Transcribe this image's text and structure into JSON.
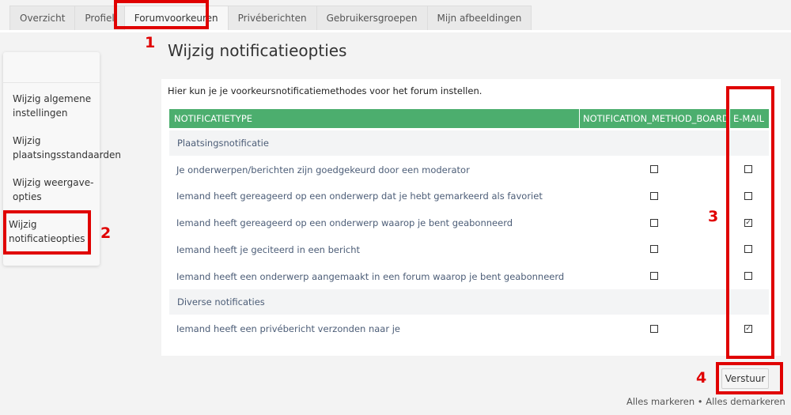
{
  "tabs": [
    "Overzicht",
    "Profiel",
    "Forumvoorkeuren",
    "Privéberichten",
    "Gebruikersgroepen",
    "Mijn afbeeldingen"
  ],
  "sidebar": {
    "items": [
      {
        "line1": "Wijzig algemene",
        "line2": "instellingen"
      },
      {
        "line1": "Wijzig",
        "line2": "plaatsingsstandaarden"
      },
      {
        "line1": "Wijzig weergave-",
        "line2": "opties"
      },
      {
        "line1": "Wijzig",
        "line2": "notificatieopties"
      }
    ]
  },
  "main": {
    "title": "Wijzig notificatieopties",
    "intro": "Hier kun je je voorkeursnotificatiemethodes voor het forum instellen.",
    "columns": [
      "Notificatietype",
      "NOTIFICATION_METHOD_BOARD",
      "E-mail"
    ],
    "groups": [
      "Plaatsingsnotificatie",
      "Diverse notificaties"
    ],
    "rows": [
      {
        "label": "Je onderwerpen/berichten zijn goedgekeurd door een moderator",
        "board": false,
        "email": false
      },
      {
        "label": "Iemand heeft gereageerd op een onderwerp dat je hebt gemarkeerd als favoriet",
        "board": false,
        "email": false
      },
      {
        "label": "Iemand heeft gereageerd op een onderwerp waarop je bent geabonneerd",
        "board": false,
        "email": true
      },
      {
        "label": "Iemand heeft je geciteerd in een bericht",
        "board": false,
        "email": false
      },
      {
        "label": "Iemand heeft een onderwerp aangemaakt in een forum waarop je bent geabonneerd",
        "board": false,
        "email": false
      },
      {
        "label": "Iemand heeft een privébericht verzonden naar je",
        "board": false,
        "email": true
      }
    ],
    "submit_label": "Verstuur",
    "mark_all": "Alles markeren",
    "mark_separator": "•",
    "unmark_all": "Alles demarkeren"
  },
  "annotations": [
    "1",
    "2",
    "3",
    "4"
  ],
  "colors": {
    "header_green": "#4cae6e",
    "annotation_red": "#e00000",
    "label_blue": "#4c5d77"
  }
}
